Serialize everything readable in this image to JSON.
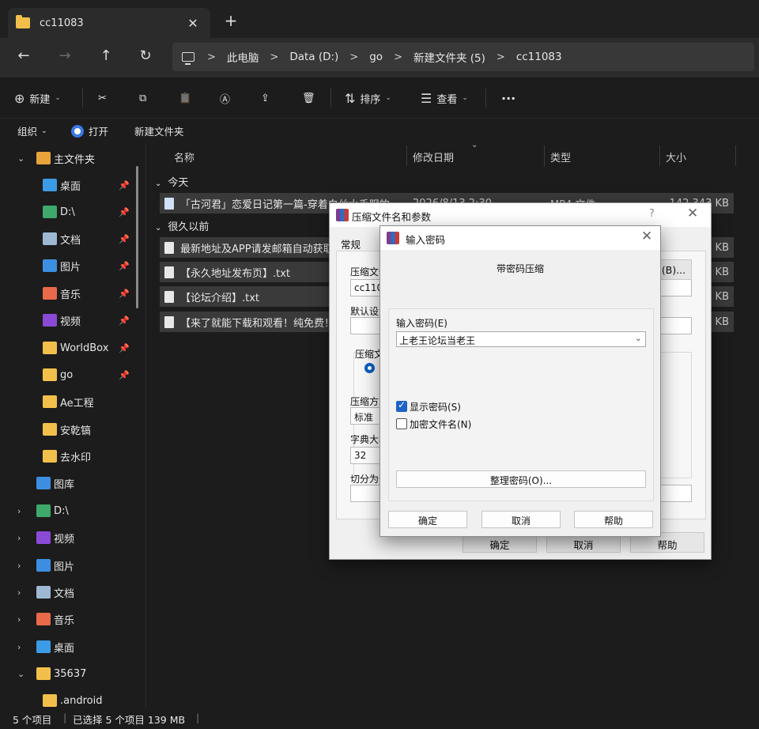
{
  "tab": {
    "title": "cc11083",
    "close": "✕",
    "new_tab": "+"
  },
  "nav": {
    "back": "←",
    "forward": "→",
    "up": "↑",
    "refresh": "↻"
  },
  "breadcrumb": [
    "此电脑",
    "Data (D:)",
    "go",
    "新建文件夹 (5)",
    "cc11083"
  ],
  "breadcrumb_sep": ">",
  "commands": {
    "new_label": "新建",
    "sort_label": "排序",
    "view_label": "查看",
    "more": "···",
    "cut": "✂",
    "copy": "⧉",
    "paste": "📋",
    "rename": "Ⓐ",
    "share": "⇪",
    "delete": "🗑"
  },
  "subbar": {
    "organize": "组织",
    "open": "打开",
    "new_folder": "新建文件夹"
  },
  "sidebar": {
    "items": [
      {
        "label": "主文件夹",
        "chev": "⌄",
        "icon": "home-icon",
        "color": "#e8a33a"
      },
      {
        "label": "桌面",
        "pin": "📌",
        "icon": "desktop-icon",
        "color": "#3c9be6"
      },
      {
        "label": "D:\\",
        "pin": "📌",
        "icon": "download-icon",
        "color": "#3fa86b"
      },
      {
        "label": "文档",
        "pin": "📌",
        "icon": "document-icon",
        "color": "#9eb7d2"
      },
      {
        "label": "图片",
        "pin": "📌",
        "icon": "pictures-icon",
        "color": "#3c8fe0"
      },
      {
        "label": "音乐",
        "pin": "📌",
        "icon": "music-icon",
        "color": "#e86a4a"
      },
      {
        "label": "视频",
        "pin": "📌",
        "icon": "video-icon",
        "color": "#8a4ad6"
      },
      {
        "label": "WorldBox",
        "pin": "📌",
        "icon": "folder-icon",
        "color": "#f2c04a"
      },
      {
        "label": "go",
        "pin": "📌",
        "icon": "folder-icon",
        "color": "#f2c04a"
      },
      {
        "label": "Ae工程",
        "icon": "folder-icon",
        "color": "#f2c04a"
      },
      {
        "label": "安乾镐",
        "icon": "folder-icon",
        "color": "#f2c04a"
      },
      {
        "label": "去水印",
        "icon": "folder-icon",
        "color": "#f2c04a"
      },
      {
        "label": "图库",
        "icon": "gallery-icon",
        "color": "#3c8fe0"
      },
      {
        "label": "D:\\",
        "chev": "›",
        "icon": "download-icon",
        "color": "#3fa86b"
      },
      {
        "label": "视频",
        "chev": "›",
        "icon": "video-icon",
        "color": "#8a4ad6"
      },
      {
        "label": "图片",
        "chev": "›",
        "icon": "pictures-icon",
        "color": "#3c8fe0"
      },
      {
        "label": "文档",
        "chev": "›",
        "icon": "document-icon",
        "color": "#9eb7d2"
      },
      {
        "label": "音乐",
        "chev": "›",
        "icon": "music-icon",
        "color": "#e86a4a"
      },
      {
        "label": "桌面",
        "chev": "›",
        "icon": "desktop-icon",
        "color": "#3c9be6"
      },
      {
        "label": "35637",
        "chev": "⌄",
        "icon": "folder-icon",
        "color": "#f2c04a"
      },
      {
        "label": ".android",
        "icon": "folder-icon",
        "color": "#f2c04a"
      }
    ]
  },
  "columns": {
    "name": "名称",
    "modified": "修改日期",
    "type": "类型",
    "size": "大小"
  },
  "groups": {
    "today": "今天",
    "long_ago": "很久以前"
  },
  "files": [
    {
      "name": "「古河君」恋爱日记第一篇-穿着白丝水手服的",
      "date": "2026/8/13 2:30",
      "type": "MP4 文件",
      "size": "142,343 KB",
      "kind": "video"
    },
    {
      "name": "最新地址及APP请发邮箱自动获取",
      "date": "",
      "type": "",
      "size": "KB",
      "kind": "text"
    },
    {
      "name": "【永久地址发布页】.txt",
      "date": "",
      "type": "",
      "size": "KB",
      "kind": "text"
    },
    {
      "name": "【论坛介绍】.txt",
      "date": "",
      "type": "",
      "size": "2 KB",
      "kind": "text"
    },
    {
      "name": "【来了就能下载和观看！纯免费！",
      "date": "",
      "type": "",
      "size": "2 KB",
      "kind": "text"
    }
  ],
  "status": {
    "count": "5 个项目",
    "selected": "已选择 5 个项目  139 MB"
  },
  "dialog_archive": {
    "title": "压缩文件名和参数",
    "help_q": "?",
    "close": "✕",
    "tab_general": "常规",
    "lbl_archive": "压缩文件",
    "archive_value": "cc11083",
    "lbl_default": "默认设置",
    "lbl_format": "压缩文",
    "lbl_method": "压缩方式",
    "method_value": "标准",
    "lbl_dict": "字典大小",
    "dict_value": "32",
    "lbl_split": "切分为分",
    "browse": "(B)...",
    "ok": "确定",
    "cancel": "取消",
    "help": "帮助"
  },
  "dialog_password": {
    "title": "输入密码",
    "close": "✕",
    "heading": "带密码压缩",
    "lbl_password": "输入密码(E)",
    "password_value": "上老王论坛当老王",
    "dropdown": "⌄",
    "show_password": "显示密码(S)",
    "show_password_checked": true,
    "encrypt_names": "加密文件名(N)",
    "encrypt_names_checked": false,
    "organize": "整理密码(O)...",
    "ok": "确定",
    "cancel": "取消",
    "help": "帮助"
  }
}
